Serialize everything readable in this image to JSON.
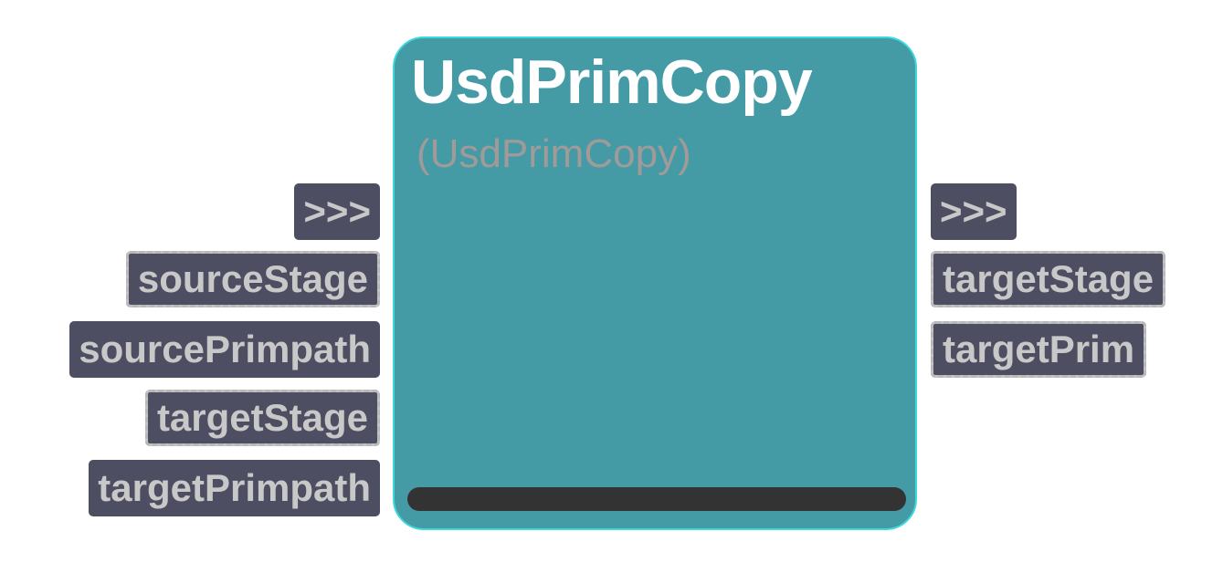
{
  "node": {
    "title": "UsdPrimCopy",
    "subtitle": "(UsdPrimCopy)",
    "progress": 1.0
  },
  "inputs": [
    {
      "label": ">>>",
      "style": "exec"
    },
    {
      "label": "sourceStage",
      "style": "dashed"
    },
    {
      "label": "sourcePrimpath",
      "style": "solid"
    },
    {
      "label": "targetStage",
      "style": "dashed"
    },
    {
      "label": "targetPrimpath",
      "style": "solid"
    }
  ],
  "outputs": [
    {
      "label": ">>>",
      "style": "exec"
    },
    {
      "label": "targetStage",
      "style": "dashed"
    },
    {
      "label": "targetPrim",
      "style": "dashed"
    }
  ],
  "colors": {
    "node_fill": "#449ba5",
    "node_border": "#3fd7dc",
    "pin_fill": "#4e4e62",
    "pin_text": "#c8c8c8",
    "progress_bar": "#333333"
  }
}
